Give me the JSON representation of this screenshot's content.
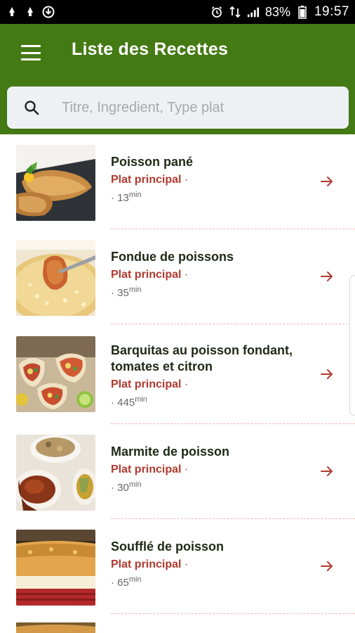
{
  "status": {
    "battery": "83%",
    "time": "19:57",
    "icons": [
      "notification-icon",
      "notification-icon",
      "download-icon",
      "alarm-icon",
      "data-icon",
      "signal-icon",
      "battery-icon"
    ]
  },
  "app": {
    "title": "Liste des Recettes",
    "bar_color": "#447a14",
    "accent_color": "#b03a2e"
  },
  "search": {
    "placeholder": "Titre, Ingredient, Type plat"
  },
  "recipes": [
    {
      "title": "Poisson pané",
      "type": "Plat principal",
      "type_sep": " ·",
      "time_prefix": "· ",
      "time": "13",
      "unit": "min"
    },
    {
      "title": "Fondue de poissons",
      "type": "Plat principal",
      "type_sep": " ·",
      "time_prefix": "· ",
      "time": "35",
      "unit": "min"
    },
    {
      "title": "Barquitas au poisson fondant, tomates et citron",
      "type": "Plat principal",
      "type_sep": " ·",
      "time_prefix": "· ",
      "time": "445",
      "unit": "min"
    },
    {
      "title": "Marmite de poisson",
      "type": "Plat principal",
      "type_sep": " ·",
      "time_prefix": "· ",
      "time": "30",
      "unit": "min"
    },
    {
      "title": "Soufflé de poisson",
      "type": "Plat principal",
      "type_sep": " ·",
      "time_prefix": "· ",
      "time": "65",
      "unit": "min"
    }
  ]
}
